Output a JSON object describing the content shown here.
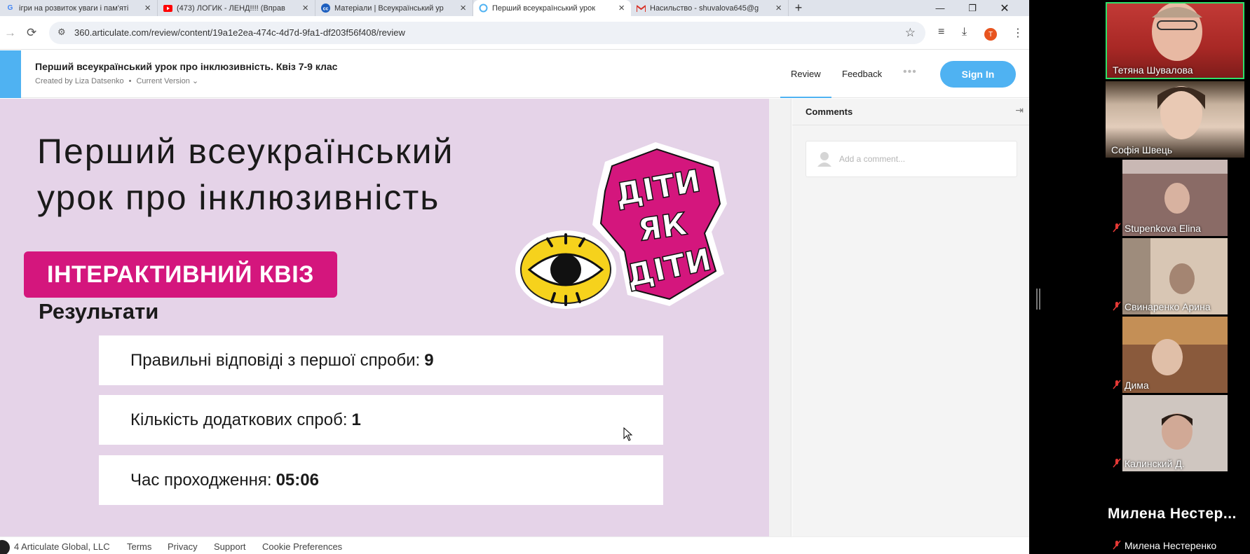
{
  "browser": {
    "tabs": [
      {
        "label": "ігри на розвиток уваги і пам'яті",
        "favicon": "google-icon",
        "active": false
      },
      {
        "label": "(473) ЛОГИК - ЛЕНД!!!! (Вправ",
        "favicon": "youtube-icon",
        "active": false
      },
      {
        "label": "Матеріали | Всеукраїнський ур",
        "favicon": "cc-icon",
        "active": false
      },
      {
        "label": "Перший всеукраїнський урок",
        "favicon": "articulate-icon",
        "active": true
      },
      {
        "label": "Насильство - shuvalova645@g",
        "favicon": "gmail-icon",
        "active": false
      }
    ],
    "new_tab": "+",
    "url": "360.articulate.com/review/content/19a1e2ea-474c-4d7d-9fa1-df203f56f408/review",
    "profile_initial": "T"
  },
  "review": {
    "title": "Перший всеукраїнський урок про інклюзивність. Квіз 7-9 клас",
    "created_by": "Created by Liza Datsenko",
    "version": "Current Version",
    "nav_review": "Review",
    "nav_feedback": "Feedback",
    "sign_in": "Sign In",
    "accent_color": "#4fb2f2"
  },
  "slide": {
    "title_line1": "Перший всеукраїнський",
    "title_line2": "урок про інклюзивність",
    "badge": "ІНТЕРАКТИВНИЙ КВІЗ",
    "badge_color": "#d4167d",
    "results_heading": "Результати",
    "rows": [
      {
        "label": "Правильні відповіді з першої спроби:",
        "value": "9"
      },
      {
        "label": "Кількість додаткових спроб:",
        "value": "1"
      },
      {
        "label": "Час проходження:",
        "value": "05:06"
      }
    ],
    "logo_lines": [
      "ДІТИ",
      "ЯК",
      "ДІТИ"
    ]
  },
  "comments": {
    "title": "Comments",
    "placeholder": "Add a comment..."
  },
  "footer": {
    "copyright": "4 Articulate Global, LLC",
    "links": [
      "Terms",
      "Privacy",
      "Support",
      "Cookie Preferences"
    ]
  },
  "call": {
    "participants": [
      {
        "name": "Тетяна Шувалова",
        "muted": false,
        "speaking": true
      },
      {
        "name": "Софія Швець",
        "muted": false
      },
      {
        "name": "Stupenkova Elina",
        "muted": true
      },
      {
        "name": "Свинаренко Арина",
        "muted": true
      },
      {
        "name": "Дима",
        "muted": true
      },
      {
        "name": "Калинский Д.",
        "muted": true
      },
      {
        "name": "Милена Нестеренко",
        "muted": true,
        "display_truncated": "Милена  Нестер..."
      }
    ]
  }
}
